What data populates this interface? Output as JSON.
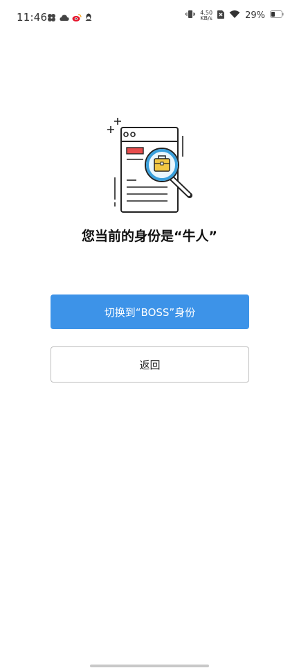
{
  "status_bar": {
    "time": "11:46",
    "net_speed_value": "4.50",
    "net_speed_unit": "KB/s",
    "battery": "29%"
  },
  "main": {
    "role_text": "您当前的身份是“牛人”",
    "switch_button_label": "切换到“BOSS”身份",
    "back_button_label": "返回"
  },
  "colors": {
    "accent": "#3d93e8",
    "illustration_blue": "#3aa0dc",
    "illustration_red": "#e74c4c",
    "illustration_yellow": "#f2c744"
  }
}
